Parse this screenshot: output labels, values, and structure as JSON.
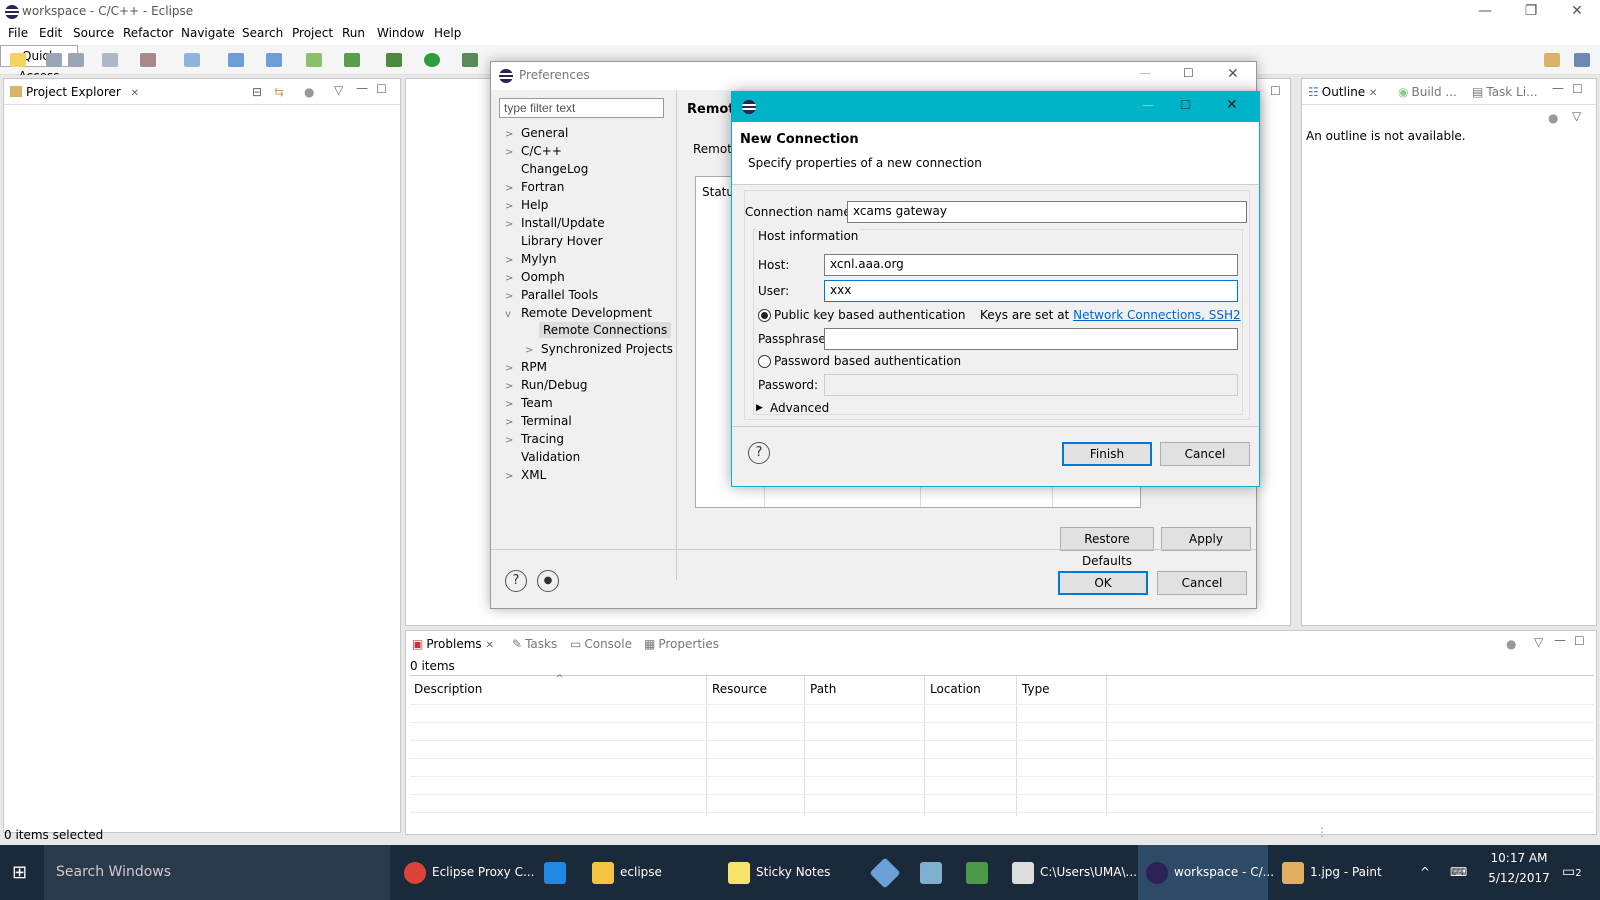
{
  "window": {
    "title": "workspace - C/C++ - Eclipse"
  },
  "menu": [
    "File",
    "Edit",
    "Source",
    "Refactor",
    "Navigate",
    "Search",
    "Project",
    "Run",
    "Window",
    "Help"
  ],
  "toolbar": {
    "quick_access": "Quick Access"
  },
  "project_explorer": {
    "tab": "Project Explorer"
  },
  "outline": {
    "tabs": [
      "Outline",
      "Build ...",
      "Task Li..."
    ],
    "message": "An outline is not available."
  },
  "preferences": {
    "title": "Preferences",
    "filter_placeholder": "type filter text",
    "page_title": "Remote",
    "page_sub": "Remote",
    "status_col": "Status",
    "tree": [
      {
        "label": "General",
        "expandable": true
      },
      {
        "label": "C/C++",
        "expandable": true
      },
      {
        "label": "ChangeLog",
        "expandable": false
      },
      {
        "label": "Fortran",
        "expandable": true
      },
      {
        "label": "Help",
        "expandable": true
      },
      {
        "label": "Install/Update",
        "expandable": true
      },
      {
        "label": "Library Hover",
        "expandable": false
      },
      {
        "label": "Mylyn",
        "expandable": true
      },
      {
        "label": "Oomph",
        "expandable": true
      },
      {
        "label": "Parallel Tools",
        "expandable": true
      },
      {
        "label": "Remote Development",
        "expandable": true,
        "expanded": true
      },
      {
        "label": "Remote Connections",
        "child": true,
        "selected": true
      },
      {
        "label": "Synchronized Projects",
        "child": true,
        "expandable": true
      },
      {
        "label": "RPM",
        "expandable": true
      },
      {
        "label": "Run/Debug",
        "expandable": true
      },
      {
        "label": "Team",
        "expandable": true
      },
      {
        "label": "Terminal",
        "expandable": true
      },
      {
        "label": "Tracing",
        "expandable": true
      },
      {
        "label": "Validation",
        "expandable": false
      },
      {
        "label": "XML",
        "expandable": true
      }
    ],
    "restore_defaults": "Restore Defaults",
    "apply": "Apply",
    "ok": "OK",
    "cancel": "Cancel"
  },
  "new_connection": {
    "heading": "New Connection",
    "subheading": "Specify properties of a new connection",
    "connection_name_label": "Connection name:",
    "connection_name": "xcams gateway",
    "host_group": "Host information",
    "host_label": "Host:",
    "host": "xcnl.aaa.org",
    "user_label": "User:",
    "user": "xxx",
    "pubkey_label": "Public key based authentication",
    "keys_note": "Keys are set at",
    "keys_link": "Network Connections, SSH2",
    "passphrase_label": "Passphrase:",
    "password_auth_label": "Password based authentication",
    "password_label": "Password:",
    "advanced": "Advanced",
    "finish": "Finish",
    "cancel": "Cancel"
  },
  "bottom": {
    "tabs": [
      "Problems",
      "Tasks",
      "Console",
      "Properties"
    ],
    "count": "0 items",
    "columns": [
      "Description",
      "Resource",
      "Path",
      "Location",
      "Type"
    ]
  },
  "status": {
    "left": "0 items selected"
  },
  "taskbar": {
    "search": "Search Windows",
    "items": [
      "Eclipse Proxy C...",
      "eclipse",
      "Sticky Notes",
      "C:\\Users\\UMA\\...",
      "workspace - C/...",
      "1.jpg - Paint"
    ],
    "time": "10:17 AM",
    "date": "5/12/2017",
    "notifications": "2"
  }
}
